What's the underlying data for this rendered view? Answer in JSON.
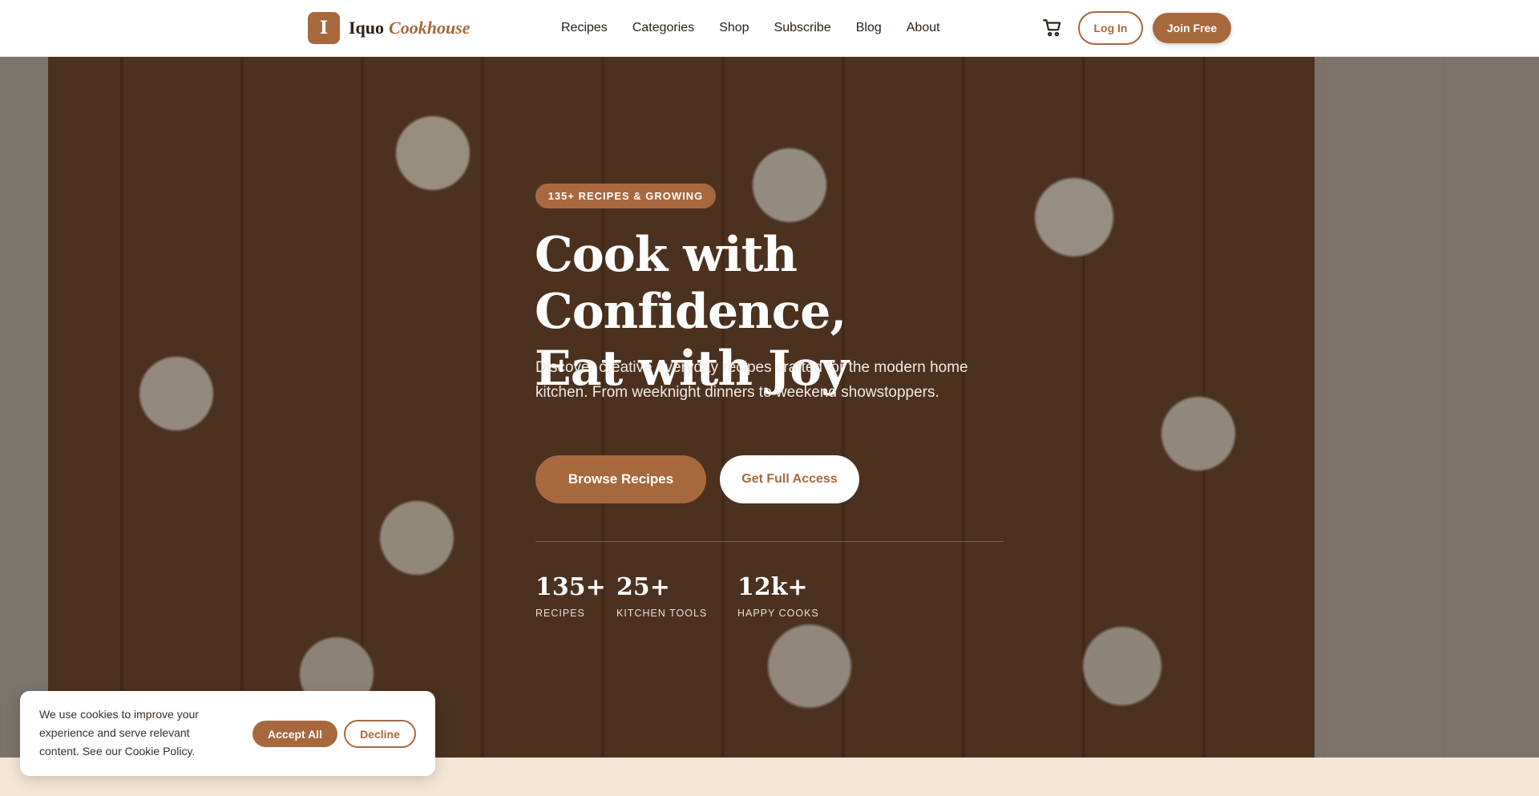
{
  "header": {
    "logo_mark": "I",
    "logo_name": "Iquo",
    "logo_accent": "Cookhouse",
    "nav": [
      "Recipes",
      "Categories",
      "Shop",
      "Subscribe",
      "Blog",
      "About"
    ],
    "login_label": "Log In",
    "join_label": "Join Free",
    "cart_icon": "cart-icon"
  },
  "hero": {
    "badge": "135+ RECIPES & GROWING",
    "title_line1": "Cook with Confidence,",
    "title_line2": "Eat with Joy",
    "subtitle": "Discover creative everyday recipes crafted for the modern home kitchen. From weeknight dinners to weekend showstoppers.",
    "browse_label": "Browse Recipes",
    "access_label": "Get Full Access",
    "stats": [
      {
        "value": "135+",
        "label": "RECIPES"
      },
      {
        "value": "25+",
        "label": "KITCHEN TOOLS"
      },
      {
        "value": "12k+",
        "label": "HAPPY COOKS"
      }
    ]
  },
  "cookie": {
    "text": "We use cookies to improve your experience and serve relevant content. See our Cookie Policy.",
    "accept_label": "Accept All",
    "decline_label": "Decline"
  },
  "colors": {
    "accent": "#a8683e",
    "background": "#f6e6d4"
  }
}
